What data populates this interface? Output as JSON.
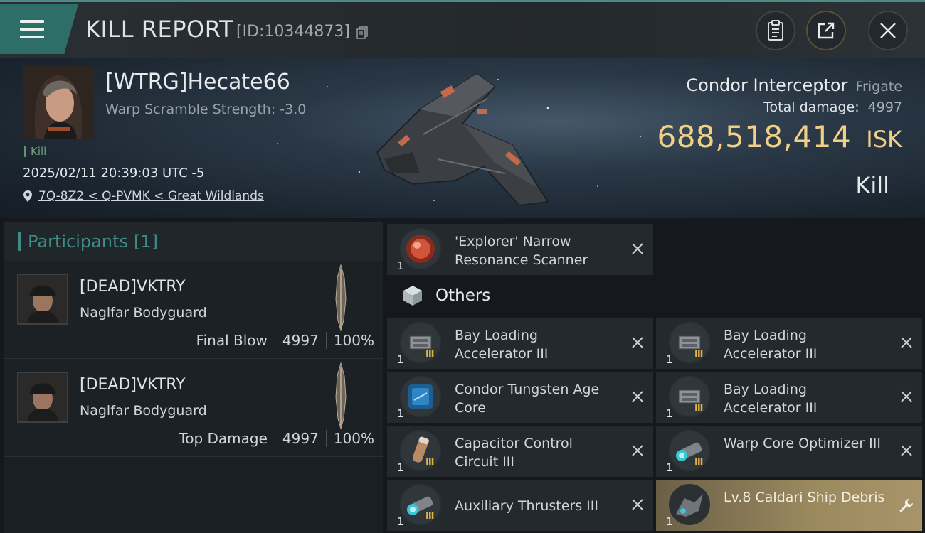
{
  "header": {
    "title": "KILL REPORT",
    "report_id": "[ID:10344873]"
  },
  "victim": {
    "pilot": "[WTRG]Hecate66",
    "warp_scramble": "Warp Scramble Strength: -3.0",
    "kill_tag": "Kill",
    "timestamp": "2025/02/11 20:39:03 UTC -5",
    "location": "7Q-8Z2 < Q-PVMK < Great Wildlands",
    "ship_name": "Condor Interceptor",
    "ship_class": "Frigate",
    "total_damage_label": "Total damage:",
    "total_damage": "4997",
    "isk_value": "688,518,414",
    "isk_unit": "ISK",
    "result": "Kill"
  },
  "participants": {
    "title": "Participants",
    "count": "[1]",
    "rows": [
      {
        "name": "[DEAD]VKTRY",
        "ship": "Naglfar Bodyguard",
        "role": "Final Blow",
        "damage": "4997",
        "percent": "100%"
      },
      {
        "name": "[DEAD]VKTRY",
        "ship": "Naglfar Bodyguard",
        "role": "Top Damage",
        "damage": "4997",
        "percent": "100%"
      }
    ]
  },
  "items": {
    "scanner": {
      "qty": "1",
      "name": "'Explorer' Narrow Resonance Scanner"
    },
    "others_title": "Others",
    "others": [
      {
        "qty": "1",
        "tier": "III",
        "name": "Bay Loading Accelerator III"
      },
      {
        "qty": "1",
        "tier": "III",
        "name": "Bay Loading Accelerator III"
      },
      {
        "qty": "1",
        "tier": "",
        "name": "Condor Tungsten Age Core"
      },
      {
        "qty": "1",
        "tier": "III",
        "name": "Bay Loading Accelerator III"
      },
      {
        "qty": "1",
        "tier": "III",
        "name": "Capacitor Control Circuit III"
      },
      {
        "qty": "1",
        "tier": "III",
        "name": "Warp Core Optimizer III"
      },
      {
        "qty": "1",
        "tier": "III",
        "name": "Auxiliary Thrusters III"
      },
      {
        "qty": "1",
        "tier": "",
        "name": "Lv.8 Caldari Ship Debris"
      }
    ]
  },
  "colors": {
    "accent_teal": "#3f8c86",
    "isk_gold": "#f1cf87",
    "tier_gold": "#e2b44a",
    "highlight_gold": "#9c8a5f"
  }
}
